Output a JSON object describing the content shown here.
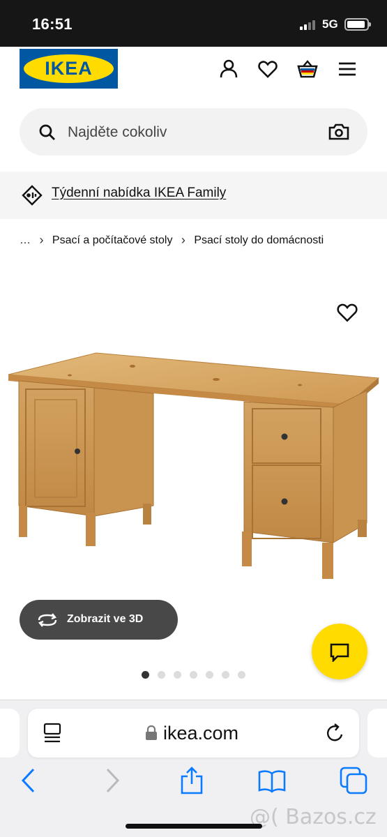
{
  "status_bar": {
    "time": "16:51",
    "network": "5G"
  },
  "header": {
    "logo_text": "IKEA",
    "icons": [
      "user-icon",
      "heart-icon",
      "basket-icon",
      "menu-icon"
    ]
  },
  "search": {
    "placeholder": "Najděte cokoliv",
    "icons": [
      "search-icon",
      "camera-icon"
    ]
  },
  "family_banner": {
    "label": "Týdenní nabídka IKEA Family",
    "icon": "tag-icon"
  },
  "breadcrumb": {
    "ellipsis": "…",
    "items": [
      "Psací a počítačové stoly",
      "Psací stoly do domácnosti"
    ],
    "separator": "›"
  },
  "product": {
    "image": "wooden-desk",
    "view_3d_label": "Zobrazit ve 3D",
    "gallery_count": 7,
    "gallery_active": 1
  },
  "colors": {
    "brand_blue": "#0058a3",
    "brand_yellow": "#ffdb00",
    "button_dark": "#484848",
    "link_blue": "#0a7aff"
  },
  "safari": {
    "url": "ikea.com"
  },
  "watermark": "@( Bazos.cz"
}
